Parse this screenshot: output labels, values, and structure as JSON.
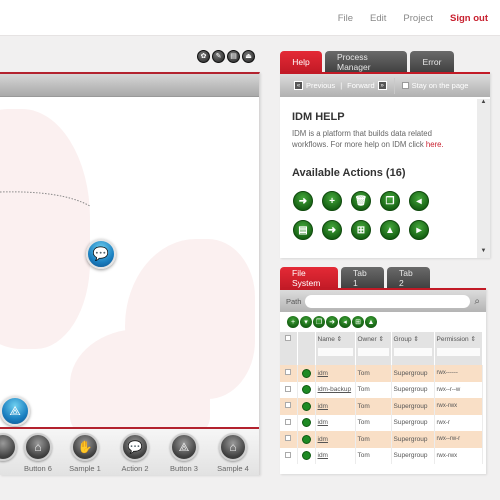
{
  "topnav": {
    "items": [
      "File",
      "Edit",
      "Project"
    ],
    "signout": "Sign out",
    "accent_color": "#c8202f"
  },
  "canvas": {
    "tool_icons": [
      "palette-icon",
      "edit-doc-icon",
      "save-icon",
      "export-icon"
    ],
    "nodes": [
      {
        "name": "chat-node",
        "icon": "chat-bubbles-icon"
      },
      {
        "name": "share-node",
        "icon": "share-icon"
      }
    ],
    "footer_buttons": [
      {
        "label": "Button 6",
        "icon": "house-icon"
      },
      {
        "label": "Sample 1",
        "icon": "hand-icon"
      },
      {
        "label": "Action 2",
        "icon": "chat-bubbles-icon"
      },
      {
        "label": "Button 3",
        "icon": "share-icon"
      },
      {
        "label": "Sample 4",
        "icon": "house-icon"
      }
    ]
  },
  "help_panel": {
    "tabs": [
      "Help",
      "Process Manager",
      "Error"
    ],
    "active_tab": "Help",
    "toolbar": {
      "previous": "Previous",
      "separator": "|",
      "forward": "Forward",
      "stay_label": "Stay on the page"
    },
    "title": "IDM HELP",
    "text": "IDM is a platform that builds data related workflows. For more help on IDM click ",
    "link": "here.",
    "actions_title": "Available Actions (16)",
    "actions": [
      "move-folder-icon",
      "add-icon",
      "delete-icon",
      "copy-icon",
      "import-icon",
      "save-icon",
      "move-folder-icon",
      "new-folder-icon",
      "upload-icon",
      "export-icon"
    ]
  },
  "fs_panel": {
    "tabs": [
      "File System",
      "Tab 1",
      "Tab 2"
    ],
    "active_tab": "File System",
    "path_label": "Path",
    "path_value": "",
    "toolbar_actions": [
      "add-icon",
      "delete-icon",
      "copy-icon",
      "move-icon",
      "import-icon",
      "new-folder-icon",
      "upload-icon"
    ],
    "columns": [
      "Name ⇕",
      "Owner ⇕",
      "Group ⇕",
      "Permission ⇕"
    ],
    "rows": [
      {
        "name": "idm",
        "owner": "Tom",
        "group": "Supergroup",
        "permission": "rwx------"
      },
      {
        "name": "idm-backup",
        "owner": "Tom",
        "group": "Supergroup",
        "permission": "rwx--r--w"
      },
      {
        "name": "idm",
        "owner": "Tom",
        "group": "Supergroup",
        "permission": "rwx-rwx"
      },
      {
        "name": "idm",
        "owner": "Tom",
        "group": "Supergroup",
        "permission": "rwx-r"
      },
      {
        "name": "idm",
        "owner": "Tom",
        "group": "Supergroup",
        "permission": "rwx--rw-r"
      },
      {
        "name": "idm",
        "owner": "Tom",
        "group": "Supergroup",
        "permission": "rwx-rwx"
      }
    ]
  }
}
